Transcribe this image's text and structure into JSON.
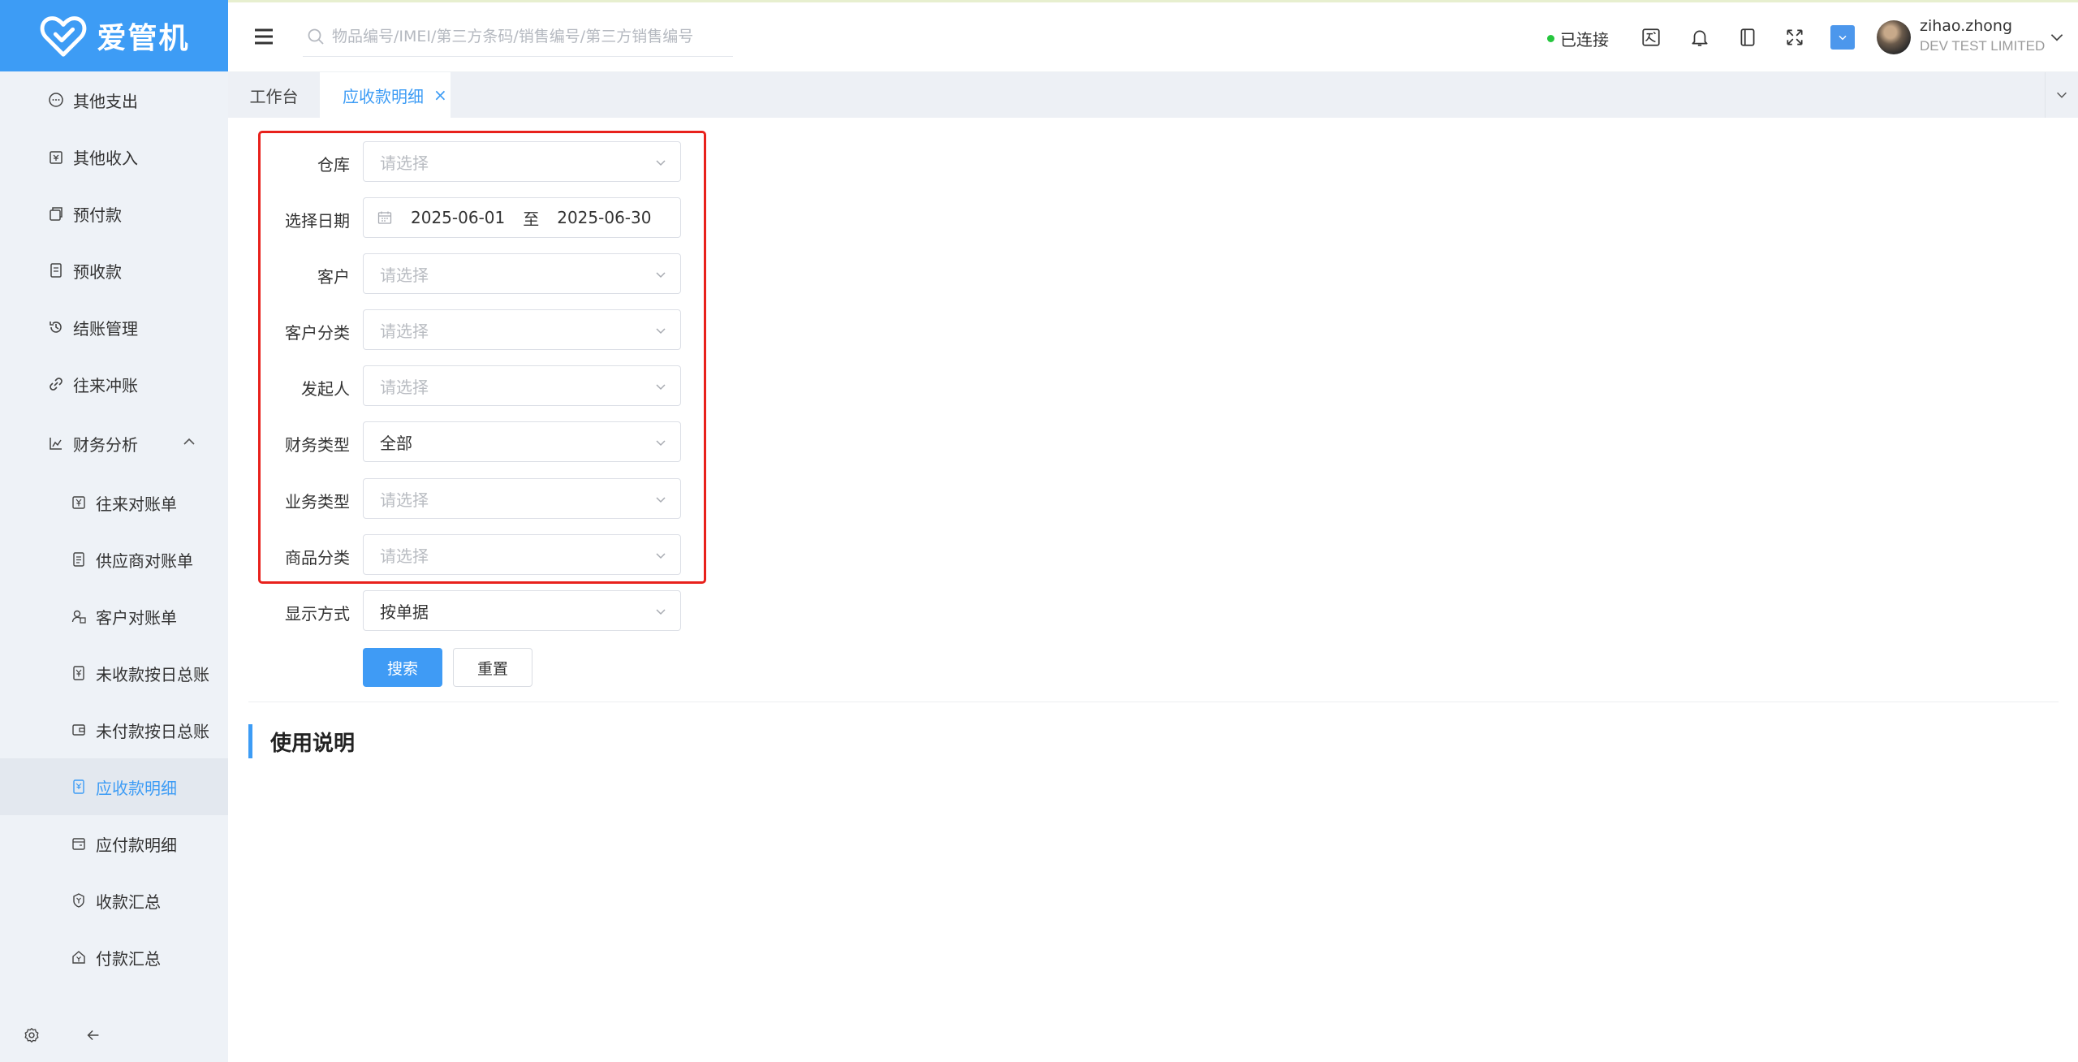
{
  "app": {
    "logo_text": "爱管机",
    "brand_color": "#3d9cf5",
    "highlight_color": "#e8211c"
  },
  "sidebar": {
    "items": [
      {
        "label": "其他支出",
        "icon": "expense-icon",
        "level": 1
      },
      {
        "label": "其他收入",
        "icon": "income-icon",
        "level": 1
      },
      {
        "label": "预付款",
        "icon": "prepay-icon",
        "level": 1
      },
      {
        "label": "预收款",
        "icon": "prereceive-icon",
        "level": 1
      },
      {
        "label": "结账管理",
        "icon": "history-icon",
        "level": 1
      },
      {
        "label": "往来冲账",
        "icon": "link-icon",
        "level": 1
      },
      {
        "label": "财务分析",
        "icon": "analysis-icon",
        "level": 1,
        "expanded": true
      },
      {
        "label": "往来对账单",
        "icon": "yen-doc-icon",
        "level": 2
      },
      {
        "label": "供应商对账单",
        "icon": "doc-icon",
        "level": 2
      },
      {
        "label": "客户对账单",
        "icon": "user-doc-icon",
        "level": 2
      },
      {
        "label": "未收款按日总账",
        "icon": "yen-doc-icon",
        "level": 2
      },
      {
        "label": "未付款按日总账",
        "icon": "wallet-icon",
        "level": 2
      },
      {
        "label": "应收款明细",
        "icon": "receivable-icon",
        "level": 2,
        "active": true
      },
      {
        "label": "应付款明细",
        "icon": "payable-icon",
        "level": 2
      },
      {
        "label": "收款汇总",
        "icon": "collect-icon",
        "level": 2
      },
      {
        "label": "付款汇总",
        "icon": "payment-icon",
        "level": 2
      }
    ]
  },
  "header": {
    "search_placeholder": "物品编号/IMEI/第三方条码/销售编号/第三方销售编号",
    "connection_status": "已连接",
    "connection_color": "#25c63d",
    "user": {
      "name": "zihao.zhong",
      "company": "DEV TEST LIMITED"
    }
  },
  "tabs": [
    {
      "label": "工作台"
    },
    {
      "label": "应收款明细",
      "closable": true,
      "close_glyph": "×"
    }
  ],
  "form": {
    "warehouse": {
      "label": "仓库",
      "placeholder": "请选择"
    },
    "date": {
      "label": "选择日期",
      "start": "2025-06-01",
      "separator": "至",
      "end": "2025-06-30"
    },
    "customer": {
      "label": "客户",
      "placeholder": "请选择"
    },
    "customer_category": {
      "label": "客户分类",
      "placeholder": "请选择"
    },
    "initiator": {
      "label": "发起人",
      "placeholder": "请选择"
    },
    "finance_type": {
      "label": "财务类型",
      "value": "全部"
    },
    "business_type": {
      "label": "业务类型",
      "placeholder": "请选择"
    },
    "product_category": {
      "label": "商品分类",
      "placeholder": "请选择"
    },
    "display_mode": {
      "label": "显示方式",
      "value": "按单据"
    },
    "search_button": "搜索",
    "reset_button": "重置"
  },
  "section": {
    "title": "使用说明"
  }
}
